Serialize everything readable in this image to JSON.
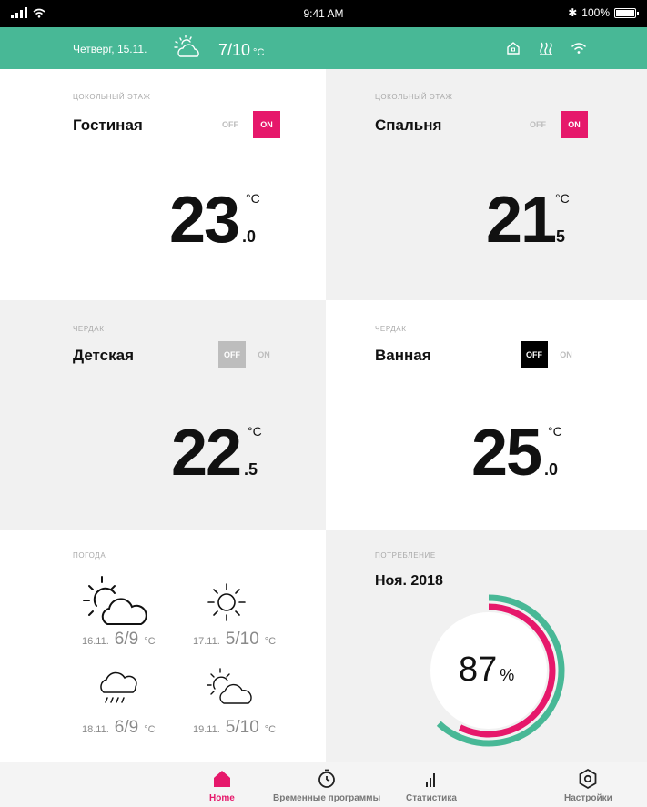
{
  "status_bar": {
    "time": "9:41 AM",
    "battery": "100%"
  },
  "header": {
    "date": "Четверг, 15.11.",
    "temp": "7/10",
    "unit": "°C"
  },
  "rooms": [
    {
      "zone": "ЦОКОЛЬНЫЙ ЭТАЖ",
      "name": "Гостиная",
      "off": "OFF",
      "on": "ON",
      "state": "on",
      "temp_int": "23",
      "temp_dec": ".0",
      "unit": "°C"
    },
    {
      "zone": "ЦОКОЛЬНЫЙ ЭТАЖ",
      "name": "Спальня",
      "off": "OFF",
      "on": "ON",
      "state": "on",
      "temp_int": "21",
      "temp_dec": ".5",
      "unit": "°C"
    },
    {
      "zone": "ЧЕРДАК",
      "name": "Детская",
      "off": "OFF",
      "on": "ON",
      "state": "off",
      "temp_int": "22",
      "temp_dec": ".5",
      "unit": "°C"
    },
    {
      "zone": "ЧЕРДАК",
      "name": "Ванная",
      "off": "OFF",
      "on": "ON",
      "state": "off",
      "temp_int": "25",
      "temp_dec": ".0",
      "unit": "°C"
    }
  ],
  "weather": {
    "title": "ПОГОДА",
    "days": [
      {
        "date": "16.11.",
        "temp": "6/9",
        "unit": "°C",
        "icon": "partly-cloudy-icon"
      },
      {
        "date": "17.11.",
        "temp": "5/10",
        "unit": "°C",
        "icon": "sun-icon"
      },
      {
        "date": "18.11.",
        "temp": "6/9",
        "unit": "°C",
        "icon": "rain-cloud-icon"
      },
      {
        "date": "19.11.",
        "temp": "5/10",
        "unit": "°C",
        "icon": "partly-cloudy-icon"
      }
    ]
  },
  "consumption": {
    "title": "ПОТРЕБЛЕНИЕ",
    "period": "Ноя. 2018",
    "value": "87",
    "unit": "%",
    "percent": 87
  },
  "tabs": [
    {
      "label": "Home",
      "icon": "home-icon"
    },
    {
      "label": "Временные программы",
      "icon": "timer-icon"
    },
    {
      "label": "Статистика",
      "icon": "stats-icon"
    },
    {
      "label": "Настройки",
      "icon": "settings-icon"
    }
  ],
  "colors": {
    "accent": "#e6186b",
    "header": "#48b896",
    "ring_outer": "#48b896"
  }
}
